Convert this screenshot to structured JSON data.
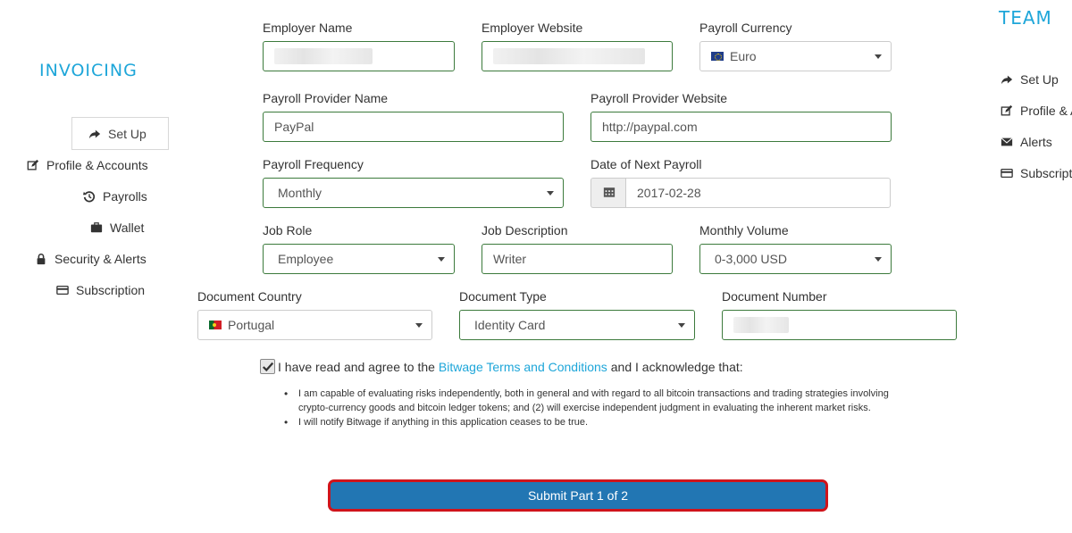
{
  "brand": {
    "left": "INVOICING",
    "right": "TEAM"
  },
  "left_nav": [
    {
      "label": "Set Up",
      "icon": "share-arrow-icon"
    },
    {
      "label": "Profile & Accounts",
      "icon": "edit-icon"
    },
    {
      "label": "Payrolls",
      "icon": "history-icon"
    },
    {
      "label": "Wallet",
      "icon": "briefcase-icon"
    },
    {
      "label": "Security & Alerts",
      "icon": "lock-icon"
    },
    {
      "label": "Subscription",
      "icon": "credit-card-icon"
    }
  ],
  "right_nav": [
    {
      "label": "Set Up",
      "icon": "share-arrow-icon"
    },
    {
      "label": "Profile & A",
      "icon": "edit-icon"
    },
    {
      "label": "Alerts",
      "icon": "envelope-icon"
    },
    {
      "label": "Subscripti",
      "icon": "credit-card-icon"
    }
  ],
  "form": {
    "employer_name": {
      "label": "Employer Name",
      "value": ""
    },
    "employer_website": {
      "label": "Employer Website",
      "value": ""
    },
    "payroll_currency": {
      "label": "Payroll Currency",
      "value": "Euro"
    },
    "payroll_provider_name": {
      "label": "Payroll Provider Name",
      "value": "PayPal"
    },
    "payroll_provider_website": {
      "label": "Payroll Provider Website",
      "value": "http://paypal.com"
    },
    "payroll_frequency": {
      "label": "Payroll Frequency",
      "value": "Monthly"
    },
    "date_next_payroll": {
      "label": "Date of Next Payroll",
      "value": "2017-02-28"
    },
    "job_role": {
      "label": "Job Role",
      "value": "Employee"
    },
    "job_description": {
      "label": "Job Description",
      "value": "Writer"
    },
    "monthly_volume": {
      "label": "Monthly Volume",
      "value": "0-3,000 USD"
    },
    "document_country": {
      "label": "Document Country",
      "value": "Portugal"
    },
    "document_type": {
      "label": "Document Type",
      "value": "Identity Card"
    },
    "document_number": {
      "label": "Document Number",
      "value": ""
    }
  },
  "agreement": {
    "checked": true,
    "prefix": "I have read and agree to the",
    "link_text": "Bitwage Terms and Conditions",
    "suffix": "and I acknowledge that:",
    "bullets": [
      "I am capable of evaluating risks independently, both in general and with regard to all bitcoin transactions and trading strategies involving crypto-currency goods and bitcoin ledger tokens; and (2) will exercise independent judgment in evaluating the inherent market risks.",
      "I will notify Bitwage if anything in this application ceases to be true."
    ]
  },
  "submit_label": "Submit Part 1 of 2",
  "colors": {
    "brand": "#1ea6d9",
    "field_border": "#3c7a3c",
    "submit_bg": "#2276b3",
    "submit_border": "#d0141b"
  }
}
